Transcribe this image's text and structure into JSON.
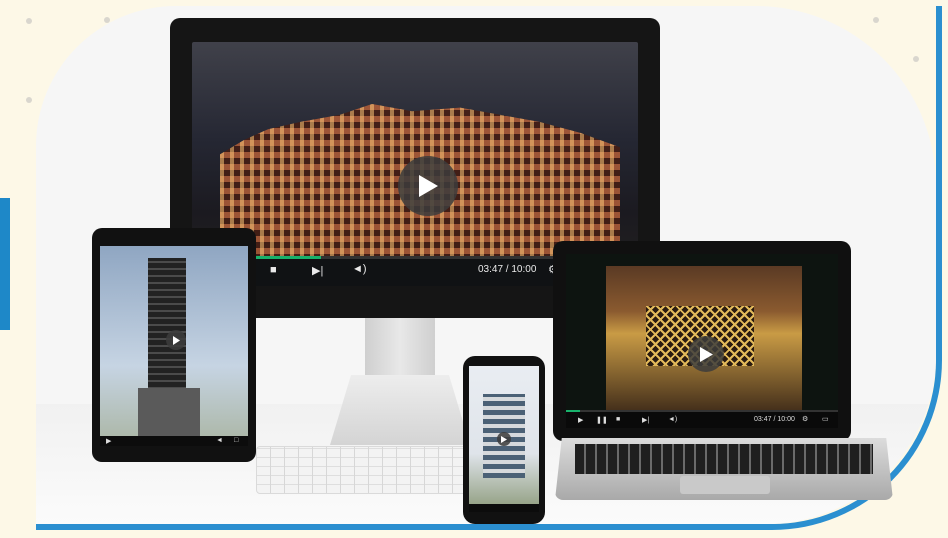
{
  "colors": {
    "background": "#fdf8e7",
    "accent_blue": "#2b8fd0",
    "progress_green": "#18b26b",
    "player_bar": "#101214"
  },
  "desktop_player": {
    "time": "03:47 / 10:00",
    "progress": 0.29,
    "icons": [
      "play-icon",
      "stop-icon",
      "next-icon",
      "volume-icon",
      "settings-icon"
    ]
  },
  "laptop_player": {
    "time": "03:47 / 10:00",
    "progress": 0.05,
    "icons": [
      "play-icon",
      "pause-icon",
      "stop-icon",
      "next-icon",
      "volume-icon",
      "settings-icon",
      "fullscreen-icon"
    ]
  },
  "tablet_player": {
    "icons": [
      "play-icon",
      "volume-icon",
      "fullscreen-icon"
    ]
  },
  "phone_player": {
    "icons": [
      "play-icon"
    ]
  }
}
